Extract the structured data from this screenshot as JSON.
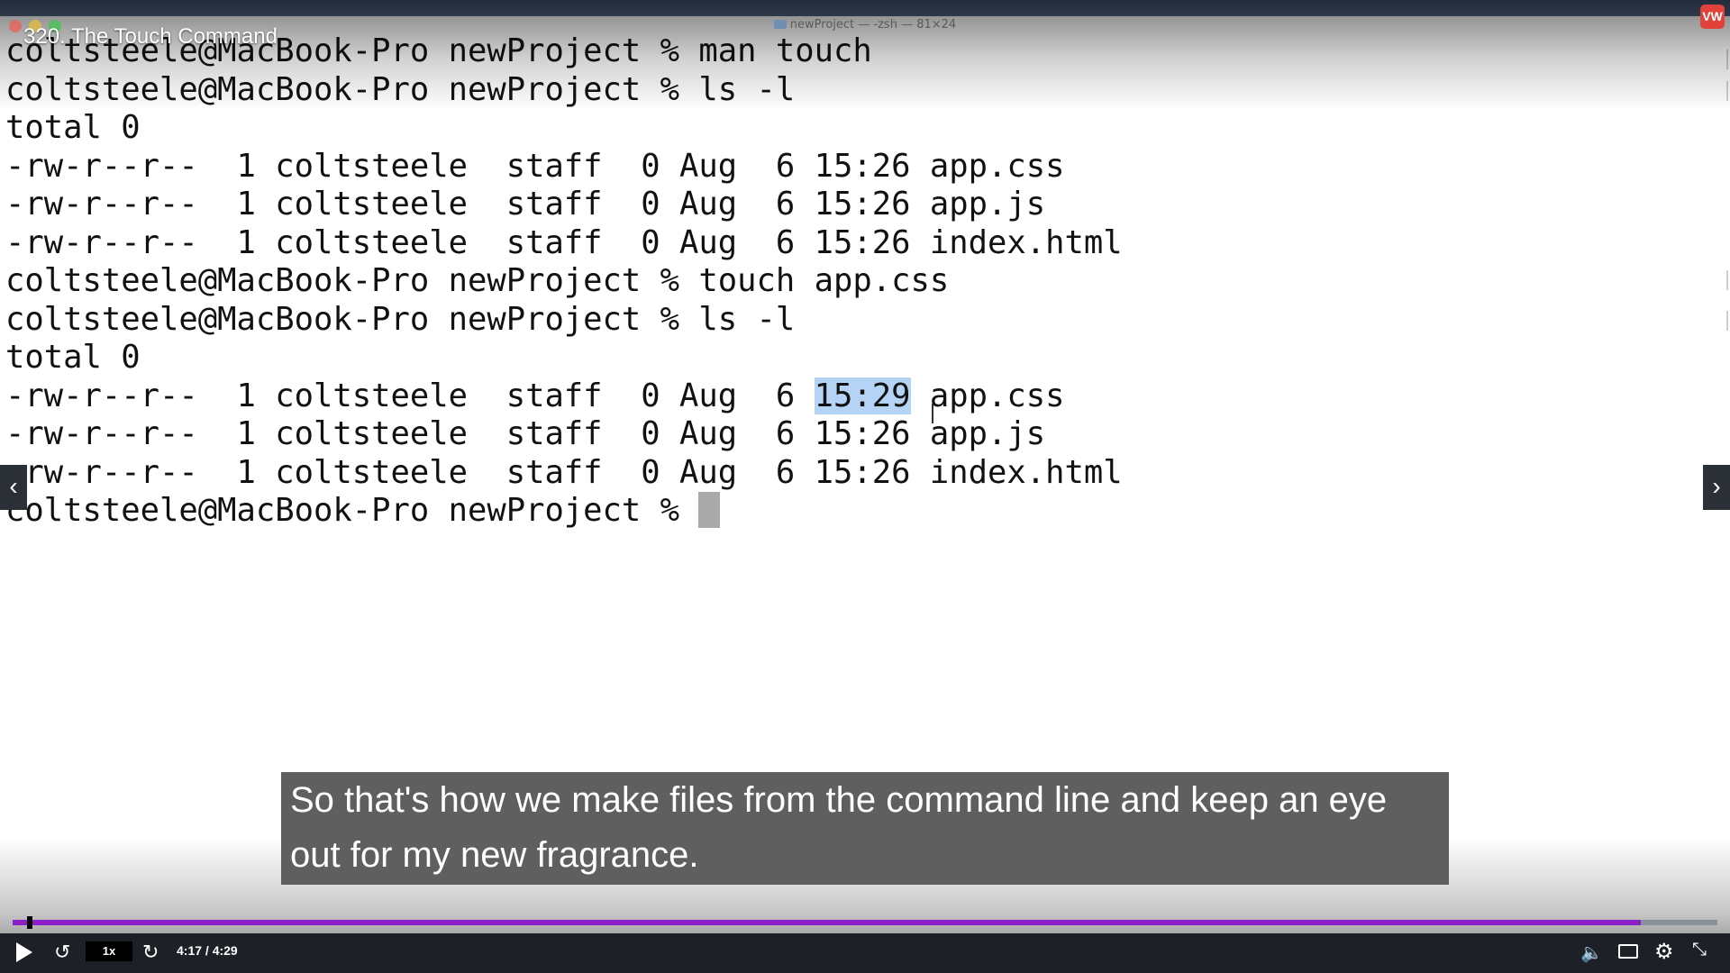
{
  "window": {
    "terminal_title": "newProject — -zsh — 81×24"
  },
  "lecture": {
    "title": "320. The Touch Command",
    "brand_icon": "vw-logo-icon",
    "brand_text": "VW",
    "brand_color": "#e0413a"
  },
  "terminal": {
    "lines": [
      "coltsteele@MacBook-Pro newProject % man touch",
      "coltsteele@MacBook-Pro newProject % ls -l",
      "total 0",
      "-rw-r--r--  1 coltsteele  staff  0 Aug  6 15:26 app.css",
      "-rw-r--r--  1 coltsteele  staff  0 Aug  6 15:26 app.js",
      "-rw-r--r--  1 coltsteele  staff  0 Aug  6 15:26 index.html",
      "coltsteele@MacBook-Pro newProject % touch app.css",
      "coltsteele@MacBook-Pro newProject % ls -l",
      "total 0"
    ],
    "highlight_line": {
      "prefix": "-rw-r--r--  1 coltsteele  staff  0 Aug  6 ",
      "selected": "15:29",
      "suffix": " app.css"
    },
    "after_lines": [
      "-rw-r--r--  1 coltsteele  staff  0 Aug  6 15:26 app.js",
      "-rw-r--r--  1 coltsteele  staff  0 Aug  6 15:26 index.html"
    ],
    "prompt": "coltsteele@MacBook-Pro newProject % ",
    "selection_color": "#b5d4f5"
  },
  "navigation": {
    "prev_icon": "chevron-left-icon",
    "prev_glyph": "‹",
    "next_icon": "chevron-right-icon",
    "next_glyph": "›"
  },
  "caption": {
    "text": "So that's how we make files from the command line and keep an eye out for my new fragrance."
  },
  "player": {
    "speed": "1x",
    "time": "4:17 / 4:29",
    "progress_fraction": 0.955,
    "buffered_fraction": 1.0,
    "progress_color": "#8a1fc9",
    "icons": [
      "play-icon",
      "rewind-icon",
      "forward-icon",
      "volume-icon",
      "captions-icon",
      "settings-icon",
      "fullscreen-icon"
    ]
  }
}
